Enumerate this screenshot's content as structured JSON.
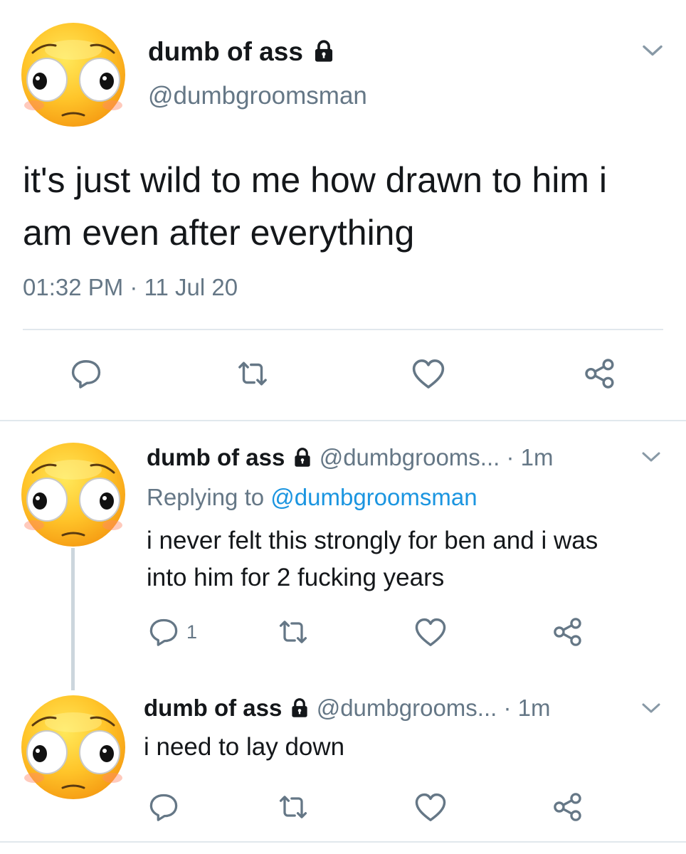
{
  "main_tweet": {
    "display_name": "dumb of ass",
    "handle": "@dumbgroomsman",
    "text": "it's just wild to me how drawn to him i am even after everything",
    "time": "01:32 PM",
    "dot": "·",
    "date": "11 Jul 20",
    "avatar_icon": "flushed-face-emoji-icon",
    "lock_icon": "lock-icon"
  },
  "replies": [
    {
      "display_name": "dumb of ass",
      "handle": "@dumbgrooms...",
      "sep": "·",
      "time": "1m",
      "replying_prefix": "Replying to",
      "replying_to": "@dumbgroomsman",
      "text_line1": "i never felt this strongly for ben and i was",
      "text_line2": "into him for 2 fucking years",
      "reply_count": "1"
    },
    {
      "display_name": "dumb of ass",
      "handle": "@dumbgrooms...",
      "sep": "·",
      "time": "1m",
      "text": "i need to lay down"
    }
  ],
  "colors": {
    "text": "#14171a",
    "muted": "#657786",
    "link": "#1b95e0",
    "divider": "#e1e8ed",
    "thread_line": "#ccd6dd"
  }
}
